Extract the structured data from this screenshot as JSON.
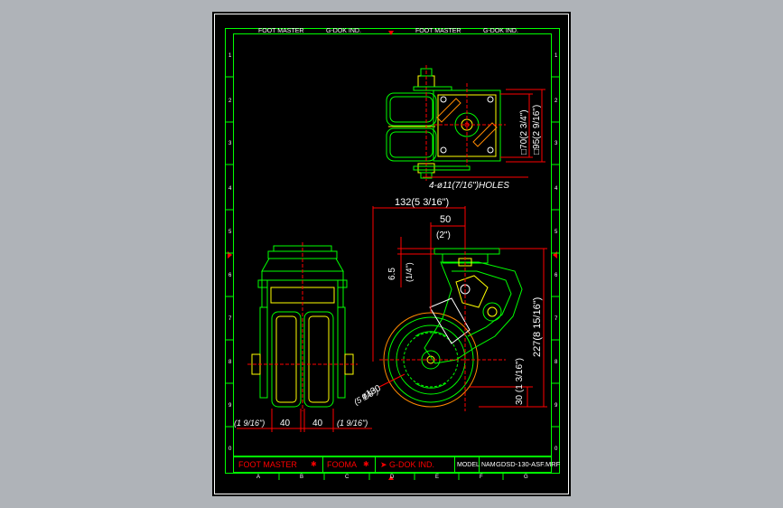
{
  "header": {
    "left_brand": "FOOT MASTER",
    "left_company": "G-DOK IND.",
    "right_brand": "FOOT MASTER",
    "right_company": "G-DOK IND."
  },
  "rows": [
    "1",
    "2",
    "3",
    "4",
    "5",
    "6",
    "7",
    "8",
    "9",
    "0"
  ],
  "columns": [
    "A",
    "B",
    "C",
    "D",
    "E",
    "F",
    "G"
  ],
  "dimensions": {
    "holes": "4-ø11(7/16\")HOLES",
    "plate_inner": "□70(2 3/4\")",
    "plate_outer": "□95(2 9/16\")",
    "overall_offset": "132(5 3/16\")",
    "swivel_offset_mm": "50",
    "swivel_offset_in": "(2\")",
    "plate_thickness_mm": "6.5",
    "plate_thickness_in": "(1/4\")",
    "overall_height": "227(8 15/16\")",
    "axle_height": "30 (1 3/16\")",
    "wheel_dia_mm": "ø130",
    "wheel_dia_in": "(5 1/8\")",
    "left_offset": "(1 9/16\")",
    "wheel_width_left": "40",
    "wheel_width_right": "40",
    "right_offset": "(1 9/16\")"
  },
  "title_block": {
    "brand": "FOOT MASTER",
    "short_brand": "FOOMA",
    "company": "G-DOK IND.",
    "model_label": "MODEL",
    "name_label": "NAM",
    "model_code": "GDSD-130-ASF.MRF"
  },
  "colors": {
    "frame": "#00ff00",
    "line": "#00ff00",
    "dimension": "#ff0000",
    "text": "#ffffff",
    "yellow": "#ffff00",
    "wheel_fill": "#ff8a00",
    "background": "#000000"
  }
}
